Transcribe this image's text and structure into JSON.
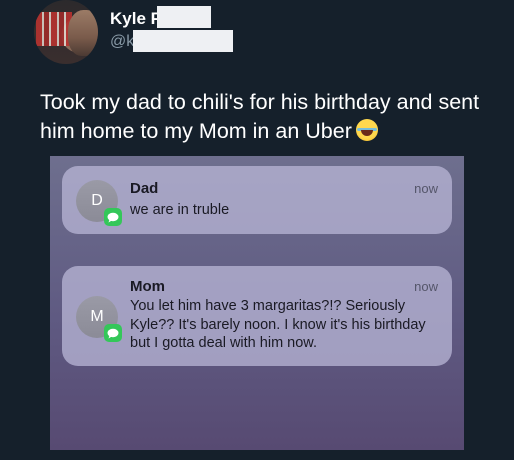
{
  "user": {
    "display_name": "Kyle P",
    "handle_prefix": "@k"
  },
  "tweet": {
    "text": "Took my dad to chili's for his birthday and sent him home to my Mom in an Uber",
    "emoji": "face-with-tears-of-joy-icon"
  },
  "notifications": [
    {
      "sender": "Dad",
      "initial": "D",
      "time": "now",
      "message": "we are in truble",
      "app_icon": "messages-icon"
    },
    {
      "sender": "Mom",
      "initial": "M",
      "time": "now",
      "message": "You let him have 3 margaritas?!? Seriously Kyle?? It's barely noon. I know it's his birthday but I gotta deal with him now.",
      "app_icon": "messages-icon"
    }
  ],
  "colors": {
    "background": "#15202b",
    "secondary_text": "#8899a6",
    "messages_green": "#34c759"
  }
}
